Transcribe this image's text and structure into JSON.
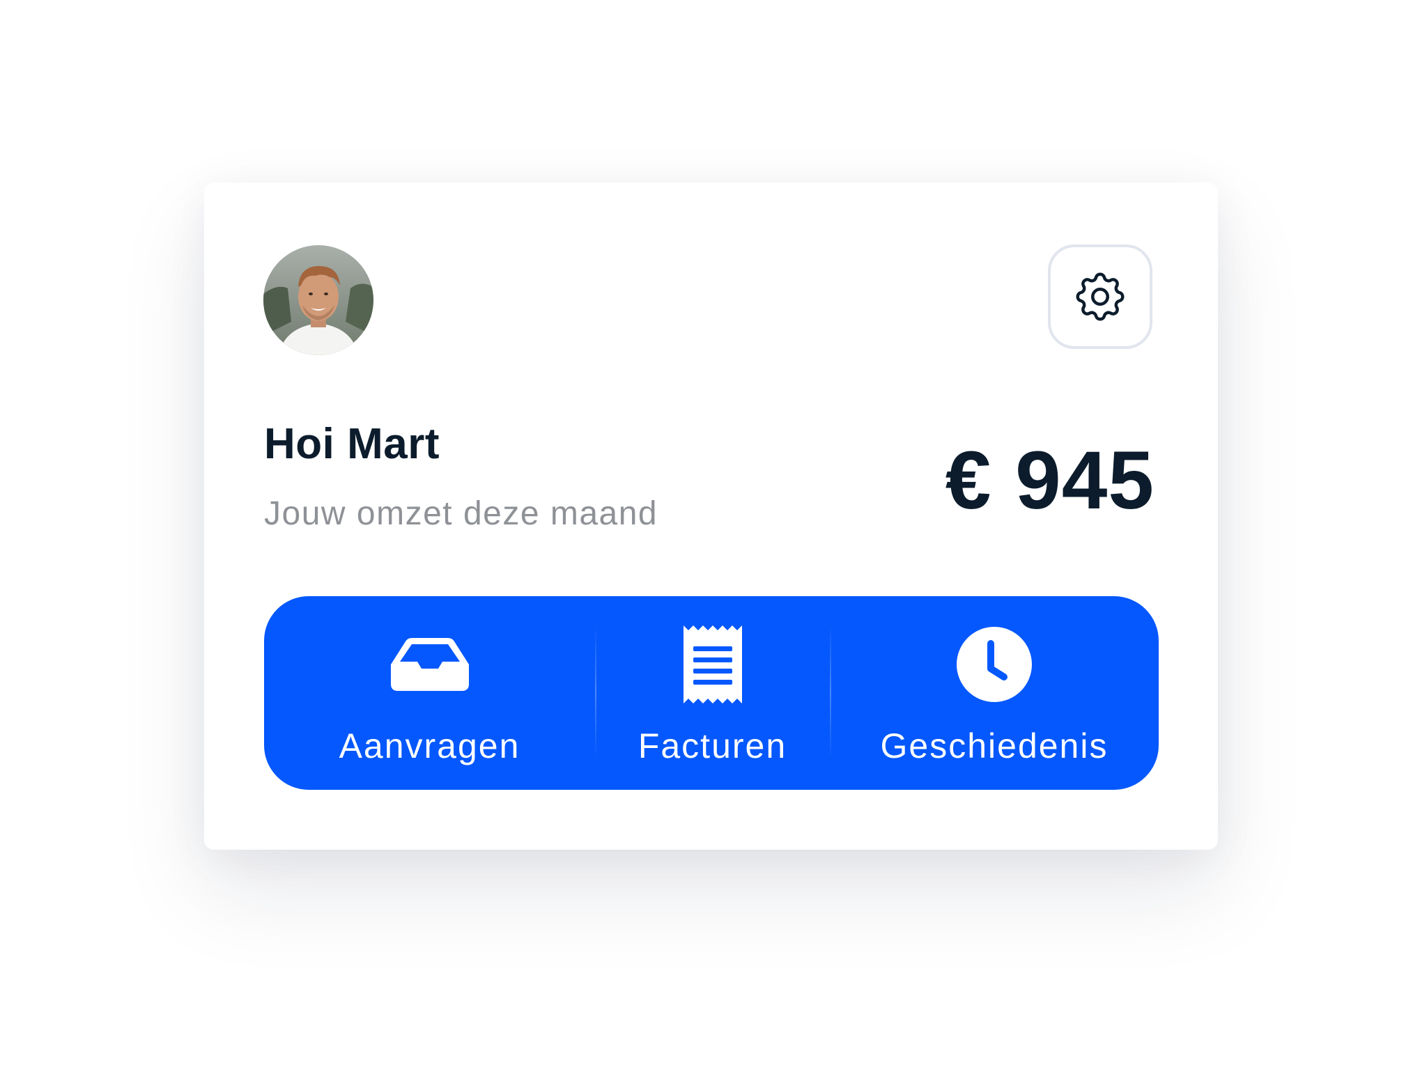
{
  "user": {
    "greeting": "Hoi Mart",
    "avatar_alt": "Mart"
  },
  "revenue": {
    "subtitle": "Jouw omzet deze maand",
    "amount": "€ 945"
  },
  "settings": {
    "icon": "gear-icon"
  },
  "actions": [
    {
      "label": "Aanvragen",
      "icon": "inbox-tray-icon"
    },
    {
      "label": "Facturen",
      "icon": "receipt-icon"
    },
    {
      "label": "Geschiedenis",
      "icon": "clock-icon"
    }
  ],
  "colors": {
    "accent": "#0558fd",
    "text_dark": "#0c1c2c",
    "text_muted": "#8e9196",
    "settings_border": "#e1e5ee"
  }
}
